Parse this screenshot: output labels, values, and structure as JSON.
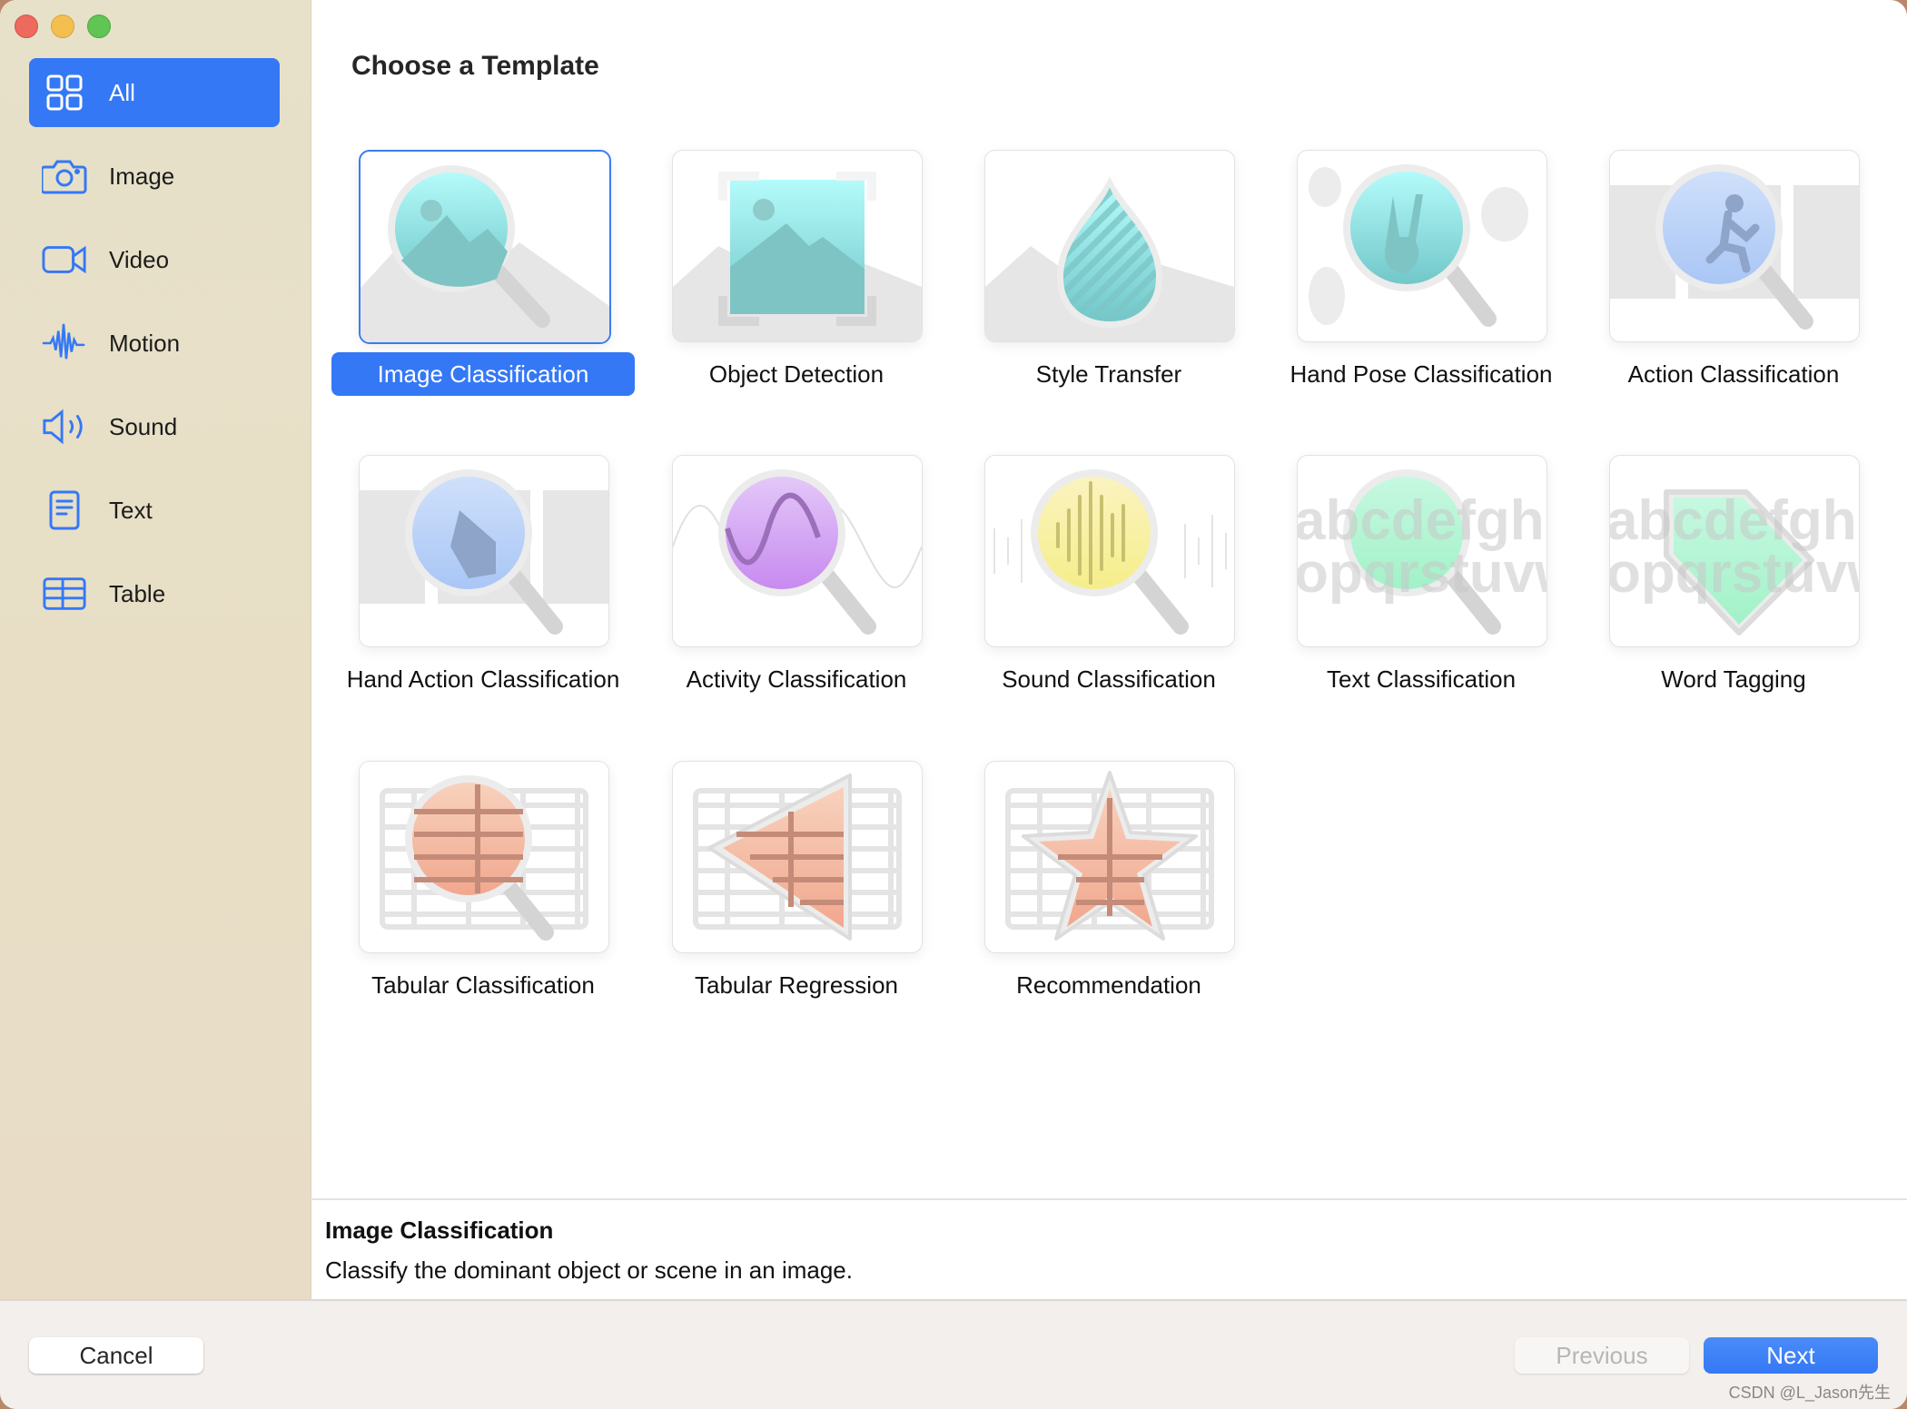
{
  "window": {
    "controls": [
      "close",
      "minimize",
      "zoom"
    ]
  },
  "sidebar": {
    "items": [
      {
        "label": "All",
        "icon": "grid-icon",
        "active": true
      },
      {
        "label": "Image",
        "icon": "camera-icon",
        "active": false
      },
      {
        "label": "Video",
        "icon": "video-camera-icon",
        "active": false
      },
      {
        "label": "Motion",
        "icon": "waveform-icon",
        "active": false
      },
      {
        "label": "Sound",
        "icon": "speaker-icon",
        "active": false
      },
      {
        "label": "Text",
        "icon": "document-icon",
        "active": false
      },
      {
        "label": "Table",
        "icon": "table-icon",
        "active": false
      }
    ]
  },
  "main": {
    "title": "Choose a Template",
    "templates": [
      {
        "label": "Image Classification",
        "icon": "image-magnifier-icon",
        "selected": true
      },
      {
        "label": "Object Detection",
        "icon": "image-bounding-box-icon",
        "selected": false
      },
      {
        "label": "Style Transfer",
        "icon": "paint-drop-icon",
        "selected": false
      },
      {
        "label": "Hand Pose Classification",
        "icon": "hand-pose-magnifier-icon",
        "selected": false
      },
      {
        "label": "Action Classification",
        "icon": "action-magnifier-icon",
        "selected": false
      },
      {
        "label": "Hand Action Classification",
        "icon": "hand-action-magnifier-icon",
        "selected": false
      },
      {
        "label": "Activity Classification",
        "icon": "wave-magnifier-icon",
        "selected": false
      },
      {
        "label": "Sound Classification",
        "icon": "audio-magnifier-icon",
        "selected": false
      },
      {
        "label": "Text Classification",
        "icon": "text-magnifier-icon",
        "selected": false
      },
      {
        "label": "Word Tagging",
        "icon": "text-tag-icon",
        "selected": false
      },
      {
        "label": "Tabular Classification",
        "icon": "table-magnifier-icon",
        "selected": false
      },
      {
        "label": "Tabular Regression",
        "icon": "table-triangle-icon",
        "selected": false
      },
      {
        "label": "Recommendation",
        "icon": "table-star-icon",
        "selected": false
      }
    ]
  },
  "detail": {
    "title": "Image Classification",
    "description": "Classify the dominant object or scene in an image."
  },
  "footer": {
    "cancel_label": "Cancel",
    "previous_label": "Previous",
    "previous_enabled": false,
    "next_label": "Next"
  },
  "watermark": "CSDN @L_Jason先生",
  "colors": {
    "accent": "#3478f6",
    "sidebar_bg": "#e8dfc7",
    "footer_bg": "#f3efec"
  }
}
